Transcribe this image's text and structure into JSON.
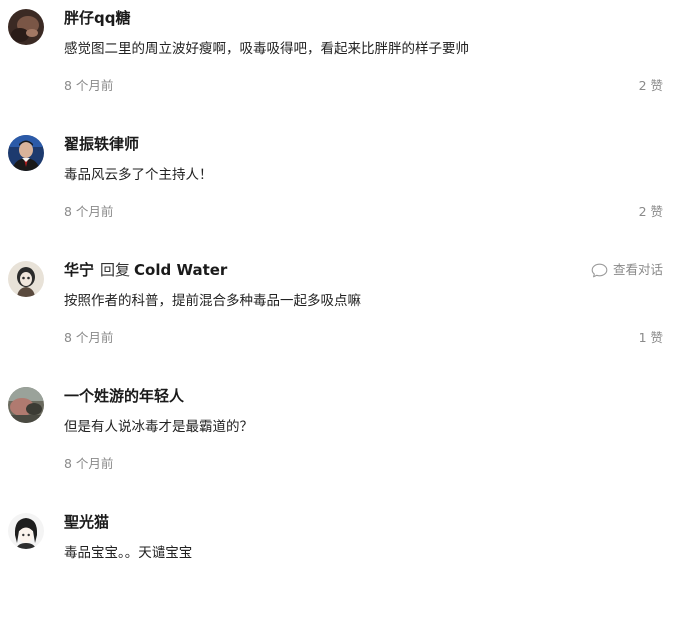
{
  "comments": [
    {
      "author": "胖仔qq糖",
      "text": "感觉图二里的周立波好瘦啊，吸毒吸得吧，看起来比胖胖的样子要帅",
      "time": "8 个月前",
      "likes": "2 赞"
    },
    {
      "author": "翟振轶律师",
      "text": "毒品风云多了个主持人！",
      "time": "8 个月前",
      "likes": "2 赞"
    },
    {
      "author": "华宁",
      "reply_word": "回复",
      "reply_target": "Cold Water",
      "view_thread": "查看对话",
      "view_thread_icon": "chat-bubble-icon",
      "text": "按照作者的科普，提前混合多种毒品一起多吸点嘛",
      "time": "8 个月前",
      "likes": "1 赞"
    },
    {
      "author": "一个姓游的年轻人",
      "text": "但是有人说冰毒才是最霸道的？",
      "time": "8 个月前"
    },
    {
      "author": "聖光猫",
      "text": "毒品宝宝。。天谴宝宝"
    }
  ]
}
